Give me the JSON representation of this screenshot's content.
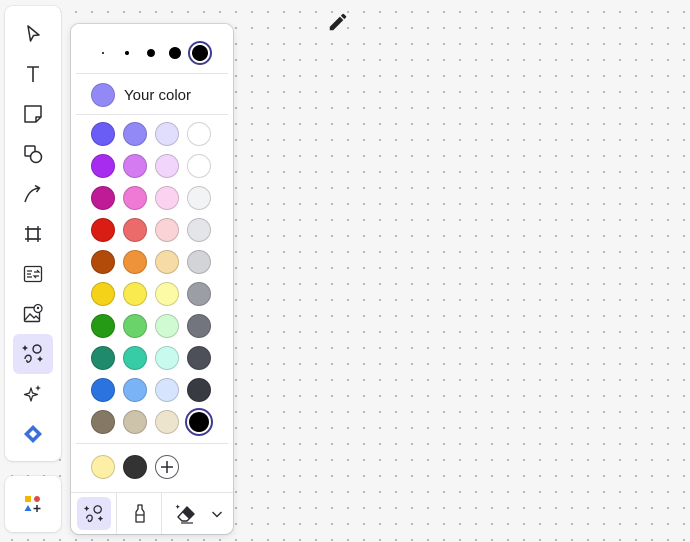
{
  "colors": {
    "accent": "#3f3c8f",
    "active_bg": "#e5e3fb",
    "your_color": "#9289f7",
    "selected": "#000000"
  },
  "toolbar": {
    "tools": [
      {
        "name": "select-tool",
        "icon": "cursor-arrow-icon"
      },
      {
        "name": "text-tool",
        "icon": "text-t-icon"
      },
      {
        "name": "sticky-note-tool",
        "icon": "sticky-note-icon"
      },
      {
        "name": "shapes-tool",
        "icon": "shapes-icon"
      },
      {
        "name": "connector-tool",
        "icon": "curved-arrow-icon"
      },
      {
        "name": "frame-tool",
        "icon": "frame-icon"
      },
      {
        "name": "text-format-tool",
        "icon": "text-swap-icon"
      },
      {
        "name": "image-tool",
        "icon": "image-icon"
      },
      {
        "name": "draw-tool",
        "icon": "draw-shapes-icon",
        "active": true
      },
      {
        "name": "ai-tool",
        "icon": "sparkle-icon"
      },
      {
        "name": "app-tool",
        "icon": "diamond-logo-icon"
      }
    ],
    "more_icon": "apps-add-icon"
  },
  "panel": {
    "stroke_sizes": [
      2,
      4,
      8,
      12,
      16
    ],
    "selected_size_index": 4,
    "your_color_label": "Your color",
    "palette": [
      [
        "#6a5cf7",
        "#9289f7",
        "#e1ddfd",
        "#ffffff"
      ],
      [
        "#a72cf0",
        "#d47bf2",
        "#f1d5fb",
        "#ffffff"
      ],
      [
        "#c01b96",
        "#ee7ad6",
        "#fbd3f1",
        "#f2f3f5"
      ],
      [
        "#d91d14",
        "#eb6a6a",
        "#f9d3d5",
        "#e4e5e8"
      ],
      [
        "#b24a0a",
        "#ef9338",
        "#f6dba4",
        "#d2d4d8"
      ],
      [
        "#f5d21a",
        "#f9ea4f",
        "#fdfaa6",
        "#9b9ea5"
      ],
      [
        "#259a14",
        "#6ad46b",
        "#d0fbd2",
        "#72757e"
      ],
      [
        "#1f8a6c",
        "#37cca6",
        "#c6fbee",
        "#4d5059"
      ],
      [
        "#2b74e0",
        "#7bb3f7",
        "#d6e5fd",
        "#393b43"
      ],
      [
        "#857864",
        "#cdc3ab",
        "#ede4cd",
        "#000000"
      ]
    ],
    "selected_color": "#000000",
    "recent_colors": [
      "#fdf0a6",
      "#333333"
    ],
    "add_icon": "plus-icon",
    "tabs": [
      {
        "name": "shapes-tab",
        "icon": "draw-shapes-icon",
        "active": true
      },
      {
        "name": "pen-tab",
        "icon": "marker-icon"
      },
      {
        "name": "eraser-tab",
        "icon": "eraser-icon"
      },
      {
        "name": "more-tab",
        "icon": "chevron-down-icon"
      }
    ]
  },
  "canvas_cursor_icon": "pencil-icon"
}
